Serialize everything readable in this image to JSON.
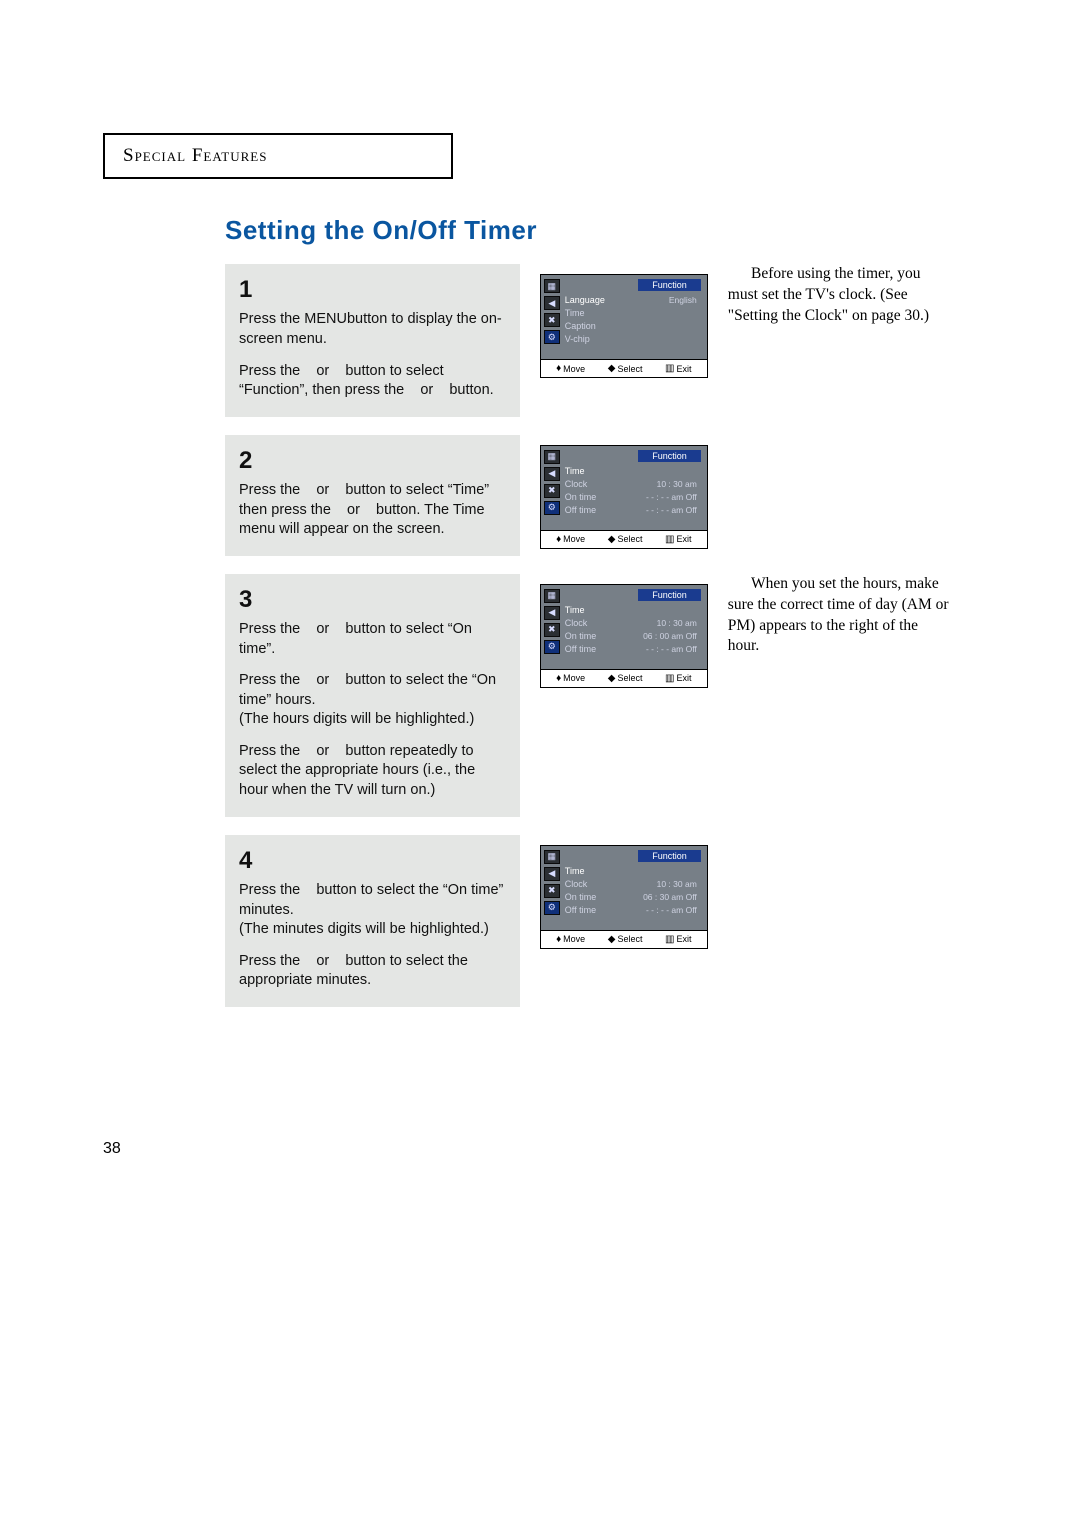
{
  "header": {
    "section": "Special Features"
  },
  "title": "Setting the On/Off Timer",
  "page_number": "38",
  "side_notes": {
    "note1": "Before using the timer, you must set the TV's clock. (See \"Setting the Clock\" on page 30.)",
    "note2": "When you set the hours, make sure the correct time of day (AM or PM) appears to the right of the hour."
  },
  "steps": {
    "s1": {
      "num": "1",
      "p1a": "Press the MENU",
      "p1b": "button to display the on-screen menu.",
      "p2": "Press the    or    button to select “Function”, then press the    or    button."
    },
    "s2": {
      "num": "2",
      "p1": "Press the    or    button to select “Time” then press the    or    button. The Time menu will appear on the screen."
    },
    "s3": {
      "num": "3",
      "p1": "Press the    or    button to select “On time”.",
      "p2": "Press the    or    button to select the “On time” hours.\n(The hours digits will be highlighted.)",
      "p3": "Press the    or    button repeatedly to select the appropriate hours (i.e., the hour when the TV will turn on.)"
    },
    "s4": {
      "num": "4",
      "p1": "Press the    button to select the “On time” minutes.\n(The minutes digits will be highlighted.)",
      "p2": "Press the    or    button to select the appropriate minutes."
    }
  },
  "osd": {
    "tag": "Function",
    "footer": {
      "move": "Move",
      "select": "Select",
      "exit": "Exit"
    },
    "icons": [
      "▦",
      "◀",
      "✖",
      "⚙"
    ],
    "menu1": {
      "rows": [
        {
          "lab": "Language",
          "val": "English",
          "hl": true
        },
        {
          "lab": "Time",
          "val": ""
        },
        {
          "lab": "Caption",
          "val": ""
        },
        {
          "lab": "V-chip",
          "val": ""
        }
      ]
    },
    "menu2": {
      "head": "Time",
      "rows": [
        {
          "lab": "Clock",
          "val": "10 : 30 am"
        },
        {
          "lab": "On time",
          "val": "- - : - - am  Off"
        },
        {
          "lab": "Off time",
          "val": "- - : - - am  Off"
        }
      ]
    },
    "menu3": {
      "head": "Time",
      "rows": [
        {
          "lab": "Clock",
          "val": "10 : 30 am"
        },
        {
          "lab": "On time",
          "val": "06 : 00 am  Off"
        },
        {
          "lab": "Off time",
          "val": "- - : - - am  Off"
        }
      ]
    },
    "menu4": {
      "head": "Time",
      "rows": [
        {
          "lab": "Clock",
          "val": "10 : 30 am"
        },
        {
          "lab": "On time",
          "val": "06 : 30 am  Off"
        },
        {
          "lab": "Off time",
          "val": "- - : - - am  Off"
        }
      ]
    }
  }
}
